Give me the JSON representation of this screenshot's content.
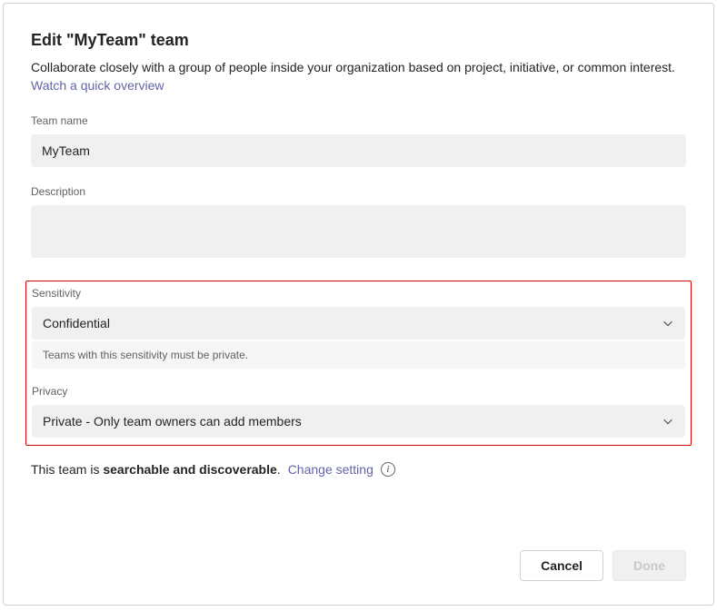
{
  "dialog": {
    "title": "Edit \"MyTeam\" team",
    "subtitle_prefix": "Collaborate closely with a group of people inside your organization based on project, initiative, or common interest. ",
    "overview_link": "Watch a quick overview"
  },
  "team_name": {
    "label": "Team name",
    "value": "MyTeam"
  },
  "description": {
    "label": "Description",
    "value": ""
  },
  "sensitivity": {
    "label": "Sensitivity",
    "value": "Confidential",
    "helper": "Teams with this sensitivity must be private."
  },
  "privacy": {
    "label": "Privacy",
    "value": "Private - Only team owners can add members"
  },
  "discoverability": {
    "prefix": "This team is ",
    "status": "searchable and discoverable",
    "suffix": ". ",
    "change_link": "Change setting"
  },
  "footer": {
    "cancel": "Cancel",
    "done": "Done"
  }
}
